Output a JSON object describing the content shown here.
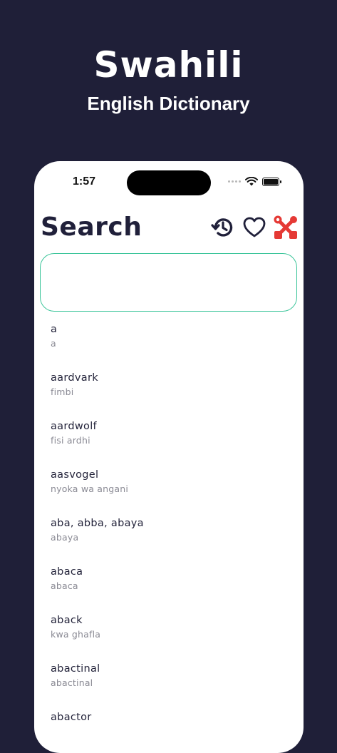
{
  "promo": {
    "title": "Swahili",
    "subtitle": "English Dictionary"
  },
  "status_bar": {
    "time": "1:57"
  },
  "header": {
    "title": "Search",
    "icons": [
      "history-icon",
      "heart-icon",
      "tools-icon"
    ],
    "colors": {
      "title": "#20203a",
      "tools_icon": "#e53935"
    }
  },
  "search": {
    "value": "",
    "placeholder": "",
    "border_color": "#3cc59a"
  },
  "entries": [
    {
      "word": "a",
      "translation": "a"
    },
    {
      "word": "aardvark",
      "translation": "fimbi"
    },
    {
      "word": "aardwolf",
      "translation": "fisi ardhi"
    },
    {
      "word": "aasvogel",
      "translation": "nyoka wa angani"
    },
    {
      "word": "aba, abba, abaya",
      "translation": "abaya"
    },
    {
      "word": "abaca",
      "translation": "abaca"
    },
    {
      "word": "aback",
      "translation": "kwa ghafla"
    },
    {
      "word": "abactinal",
      "translation": "abactinal"
    },
    {
      "word": "abactor",
      "translation": ""
    }
  ]
}
